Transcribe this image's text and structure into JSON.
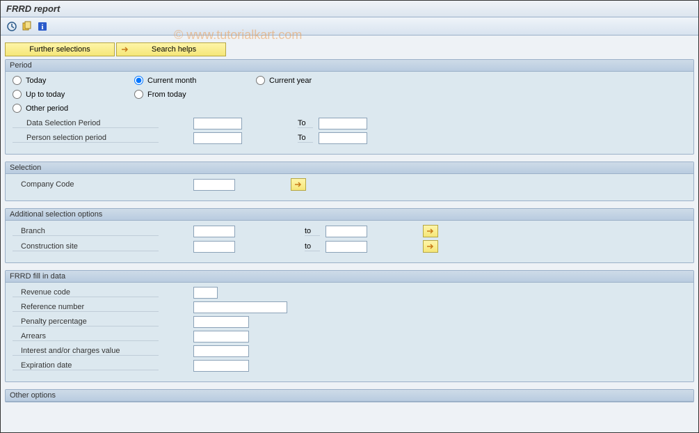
{
  "header": {
    "title": "FRRD report"
  },
  "watermark": "© www.tutorialkart.com",
  "buttons": {
    "further_selections": "Further selections",
    "search_helps": "Search helps"
  },
  "period": {
    "title": "Period",
    "today": "Today",
    "current_month": "Current month",
    "current_year": "Current year",
    "up_to_today": "Up to today",
    "from_today": "From today",
    "other_period": "Other period",
    "data_selection_period": "Data Selection Period",
    "person_selection_period": "Person selection period",
    "to": "To"
  },
  "selection": {
    "title": "Selection",
    "company_code": "Company Code"
  },
  "additional": {
    "title": "Additional selection options",
    "branch": "Branch",
    "construction_site": "Construction site",
    "to": "to"
  },
  "frrd": {
    "title": "FRRD fill in data",
    "revenue_code": "Revenue code",
    "reference_number": "Reference number",
    "penalty_percentage": "Penalty percentage",
    "arrears": "Arrears",
    "interest_charges": "Interest and/or charges value",
    "expiration_date": "Expiration date"
  },
  "other_options": {
    "title": "Other options"
  }
}
